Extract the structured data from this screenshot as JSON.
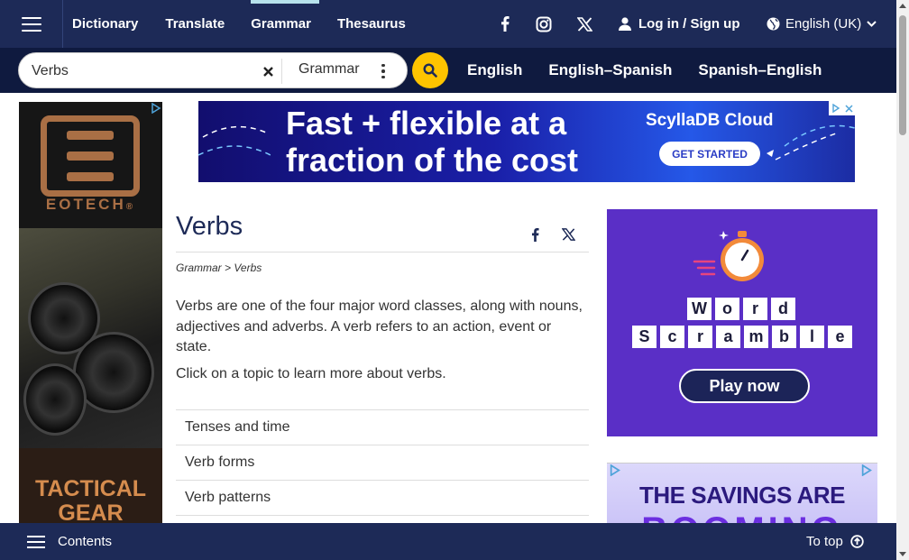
{
  "nav": {
    "links": [
      "Dictionary",
      "Translate",
      "Grammar",
      "Thesaurus"
    ],
    "active": "Grammar",
    "login_label": "Log in / Sign up",
    "language_label": "English (UK)",
    "social_icons": [
      "facebook-icon",
      "instagram-icon",
      "x-icon"
    ]
  },
  "search": {
    "value": "Verbs",
    "placeholder": "Search",
    "dictionary_selected": "Grammar",
    "quick_links": [
      "English",
      "English–Spanish",
      "Spanish–English"
    ]
  },
  "ads": {
    "left": {
      "brand": "EOTECH",
      "registered": "®",
      "tagline_line1": "TACTICAL",
      "tagline_line2": "GEAR"
    },
    "top": {
      "headline_line1": "Fast + flexible at a",
      "headline_line2": "fraction of the cost",
      "product": "ScyllaDB Cloud",
      "cta": "GET STARTED"
    },
    "word_scramble": {
      "row1": [
        "W",
        "o",
        "r",
        "d"
      ],
      "row2": [
        "S",
        "c",
        "r",
        "a",
        "m",
        "b",
        "l",
        "e"
      ],
      "cta": "Play now"
    },
    "savings": {
      "headline": "THE SAVINGS ARE",
      "partial": "BOOMING"
    }
  },
  "content": {
    "title": "Verbs",
    "breadcrumb": "Grammar > Verbs",
    "intro": "Verbs are one of the four major word classes, along with nouns, adjectives and adverbs. A verb refers to an action, event or state.",
    "intro2": "Click on a topic to learn more about verbs.",
    "topics": [
      "Tenses and time",
      "Verb forms",
      "Verb patterns"
    ]
  },
  "footer": {
    "contents_label": "Contents",
    "to_top_label": "To top"
  },
  "colors": {
    "nav_bg": "#1d2a57",
    "search_bg": "#0f1a3f",
    "search_button": "#fec400",
    "active_tab_underline": "#b7e2ec",
    "word_ad_bg": "#5a2fc6"
  }
}
